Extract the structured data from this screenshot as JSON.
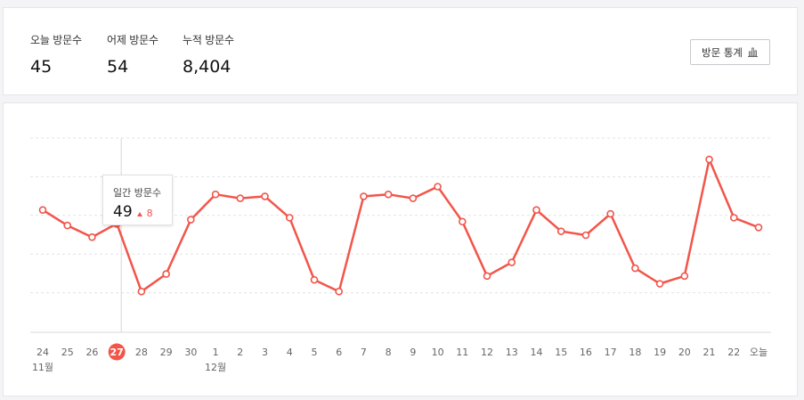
{
  "summary": {
    "today_label": "오늘 방문수",
    "today_value": "45",
    "yesterday_label": "어제 방문수",
    "yesterday_value": "54",
    "total_label": "누적 방문수",
    "total_value": "8,404",
    "stats_button_label": "방문 통계",
    "stats_button_icon": "bar-chart-icon"
  },
  "tooltip": {
    "label": "일간 방문수",
    "value": "49",
    "change": "8",
    "change_icon": "triangle-up-icon"
  },
  "colors": {
    "line": "#f2554a",
    "highlight": "#f2554a",
    "grid": "#e3e3e6",
    "axis": "#d8d8dc"
  },
  "chart_data": {
    "type": "line",
    "x": [
      "24",
      "25",
      "26",
      "27",
      "28",
      "29",
      "30",
      "1",
      "2",
      "3",
      "4",
      "5",
      "6",
      "7",
      "8",
      "9",
      "10",
      "11",
      "12",
      "13",
      "14",
      "15",
      "16",
      "17",
      "18",
      "19",
      "20",
      "21",
      "22",
      "오늘"
    ],
    "month_labels": [
      {
        "index": 0,
        "label": "11월"
      },
      {
        "index": 7,
        "label": "12월"
      }
    ],
    "highlight_index": 3,
    "series": [
      {
        "values": [
          63,
          55,
          49,
          56,
          21,
          30,
          58,
          71,
          69,
          70,
          59,
          27,
          21,
          70,
          71,
          69,
          75,
          57,
          29,
          36,
          63,
          52,
          50,
          61,
          33,
          25,
          29,
          89,
          59,
          54
        ]
      }
    ],
    "ylim": [
      0,
      100
    ],
    "grid": true,
    "legend": "none"
  }
}
